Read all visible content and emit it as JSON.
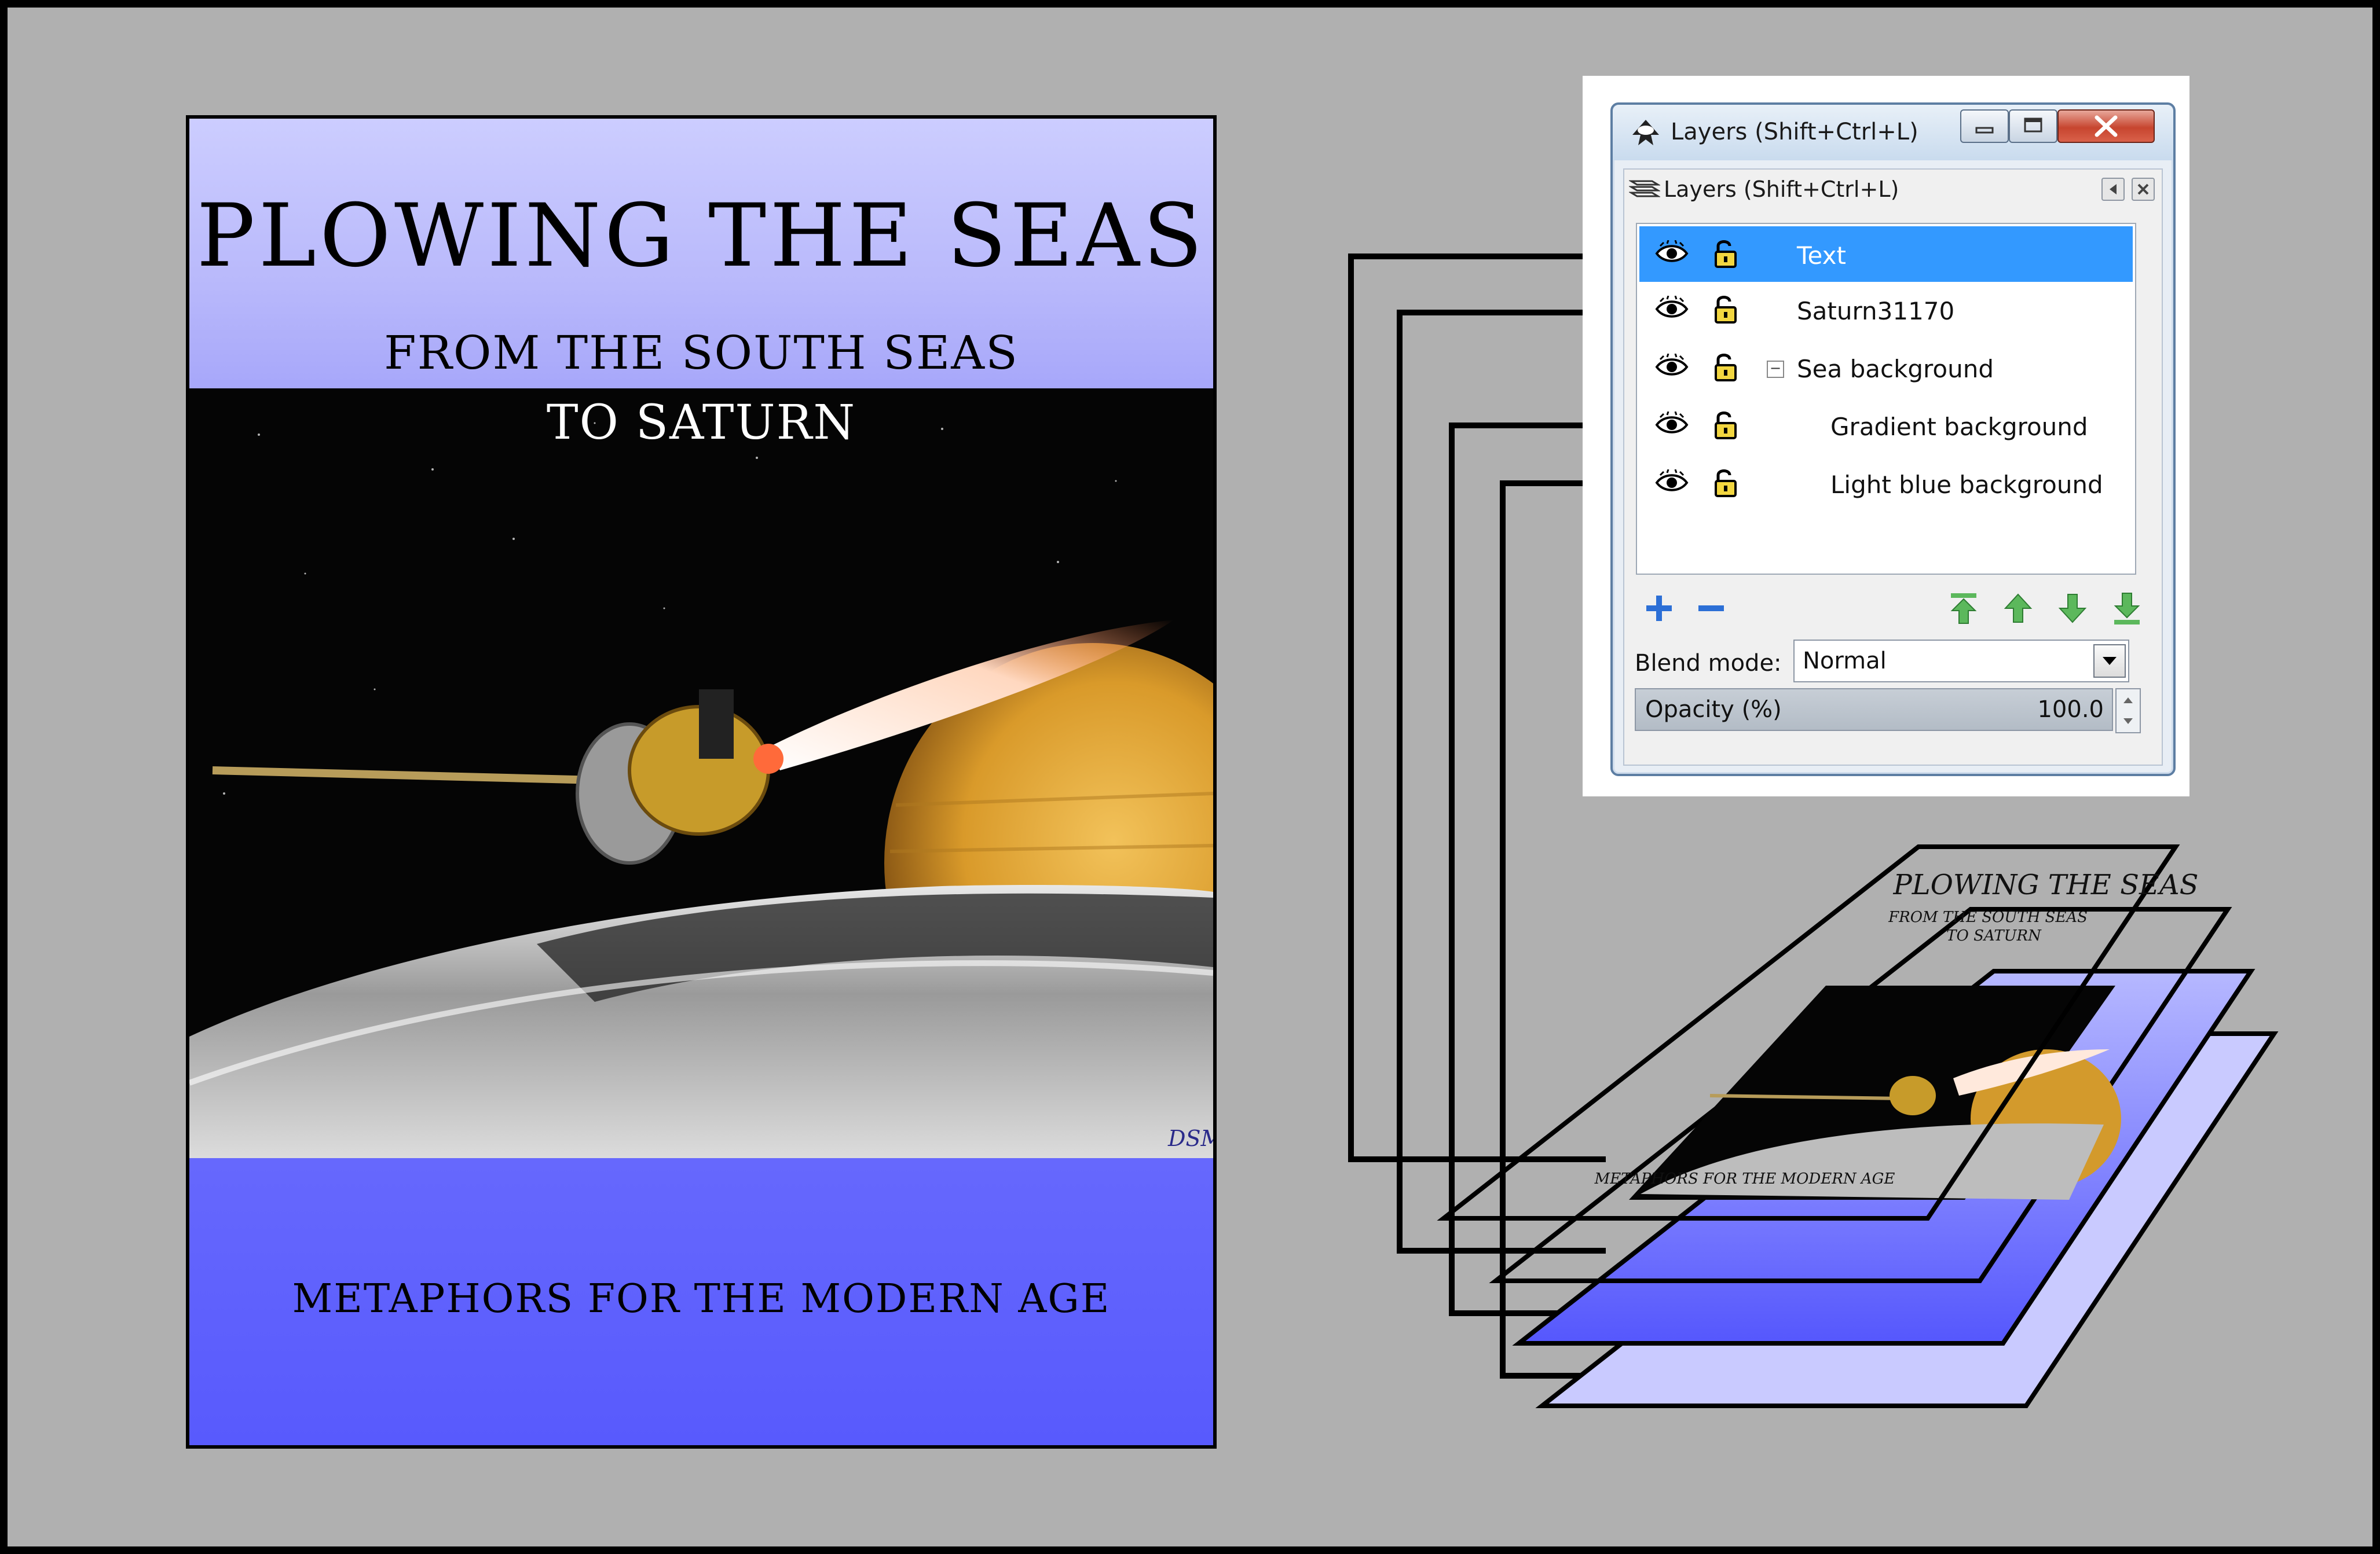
{
  "poster": {
    "title": "PLOWING THE SEAS",
    "subtitle_line1": "FROM THE SOUTH SEAS",
    "subtitle_line2": "TO SATURN",
    "footer": "METAPHORS FOR THE MODERN AGE",
    "signature": "DSM"
  },
  "dialog": {
    "window_title": "Layers (Shift+Ctrl+L)",
    "panel_title": "Layers (Shift+Ctrl+L)",
    "layers": [
      {
        "name": "Text",
        "selected": true
      },
      {
        "name": "Saturn31170",
        "selected": false
      },
      {
        "name": "Sea background",
        "selected": false,
        "collapsible": true
      },
      {
        "name": "Gradient background",
        "selected": false,
        "child": true
      },
      {
        "name": "Light blue background",
        "selected": false,
        "child": true
      }
    ],
    "toolbar_icons": [
      "add-layer-icon",
      "remove-layer-icon",
      "raise-to-top-icon",
      "raise-icon",
      "lower-icon",
      "lower-to-bottom-icon"
    ],
    "blend_mode_label": "Blend mode:",
    "blend_mode_value": "Normal",
    "opacity_label": "Opacity (%)",
    "opacity_value": "100.0"
  },
  "stack": {
    "title": "PLOWING THE SEAS",
    "subtitle_line1": "FROM THE SOUTH SEAS",
    "subtitle_line2": "TO SATURN",
    "footer": "METAPHORS FOR THE MODERN AGE"
  },
  "colors": {
    "canvas": "#b0b0b0",
    "poster_top": "#c4c5ff",
    "poster_bottom": "#5b5dfd",
    "selection": "#3399ff"
  }
}
